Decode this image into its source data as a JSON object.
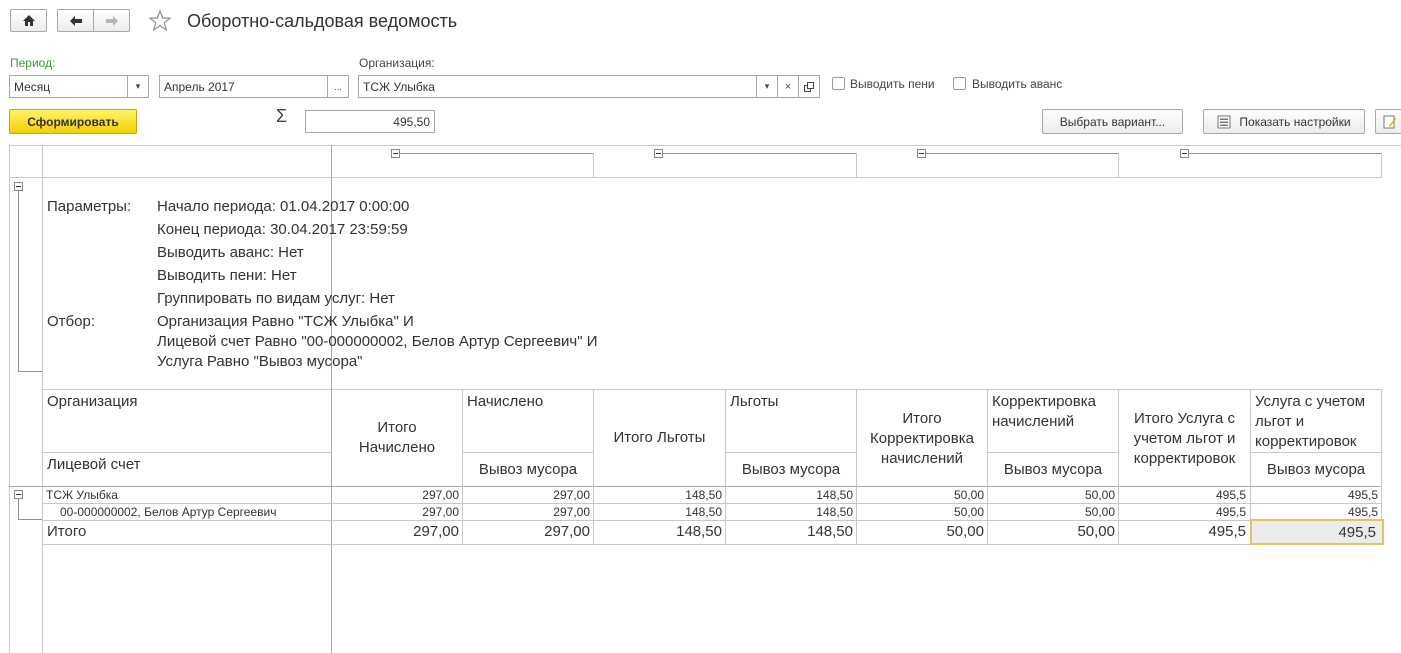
{
  "window": {
    "title": "Оборотно-сальдовая ведомость"
  },
  "filters": {
    "period_label": "Период:",
    "period_type": "Месяц",
    "period_value": "Апрель 2017",
    "period_more": "...",
    "org_label": "Организация:",
    "org_value": "ТСЖ Улыбка",
    "org_clear": "×",
    "penalty_label": "Выводить пени",
    "advance_label": "Выводить аванс"
  },
  "toolbar": {
    "generate_label": "Сформировать",
    "sigma": "Σ",
    "sum_value": "495,50",
    "variant_label": "Выбрать вариант...",
    "settings_label": "Показать настройки"
  },
  "report": {
    "params_label": "Параметры:",
    "params": [
      "Начало периода: 01.04.2017 0:00:00",
      "Конец периода: 30.04.2017 23:59:59",
      "Выводить аванс: Нет",
      "Выводить пени: Нет",
      "Группировать по видам услуг: Нет"
    ],
    "filter_label": "Отбор:",
    "filters": [
      "Организация Равно \"ТСЖ Улыбка\" И",
      "Лицевой счет Равно \"00-000000002, Белов Артур Сергеевич\" И",
      "Услуга Равно \"Вывоз мусора\""
    ],
    "header": {
      "org": "Организация",
      "account": "Лицевой счет",
      "total_accrued": "Итого Начислено",
      "accrued": "Начислено",
      "garbage1": "Вывоз мусора",
      "total_benefits": "Итого Льготы",
      "benefits": "Льготы",
      "garbage2": "Вывоз мусора",
      "total_adjust": "Итого Корректировка начислений",
      "adjust": "Корректировка начислений",
      "garbage3": "Вывоз мусора",
      "total_service": "Итого Услуга с учетом льгот и корректировок",
      "service": "Услуга с учетом льгот и корректировок",
      "garbage4": "Вывоз мусора"
    },
    "rows": [
      {
        "name": "ТСЖ Улыбка",
        "values": [
          "297,00",
          "297,00",
          "148,50",
          "148,50",
          "50,00",
          "50,00",
          "495,5",
          "495,5"
        ]
      },
      {
        "name": "00-000000002, Белов Артур Сергеевич",
        "values": [
          "297,00",
          "297,00",
          "148,50",
          "148,50",
          "50,00",
          "50,00",
          "495,5",
          "495,5"
        ]
      }
    ],
    "total": {
      "name": "Итого",
      "values": [
        "297,00",
        "297,00",
        "148,50",
        "148,50",
        "50,00",
        "50,00",
        "495,5",
        "495,5"
      ]
    }
  }
}
